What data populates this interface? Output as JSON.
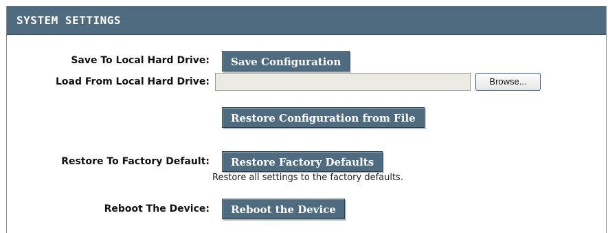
{
  "header": {
    "title": "SYSTEM SETTINGS"
  },
  "save": {
    "label": "Save To Local Hard Drive:",
    "button": "Save Configuration"
  },
  "load": {
    "label": "Load From Local Hard Drive:",
    "file_value": "",
    "browse_button": "Browse...",
    "restore_button": "Restore Configuration from File"
  },
  "factory": {
    "label": "Restore To Factory Default:",
    "button": "Restore Factory Defaults",
    "description": "Restore all settings to the factory defaults."
  },
  "reboot": {
    "label": "Reboot The Device:",
    "button": "Reboot the Device"
  },
  "colors": {
    "header_bg": "#4f6b7f",
    "button_bg": "#4f6b7f",
    "button_text": "#ffffff"
  }
}
